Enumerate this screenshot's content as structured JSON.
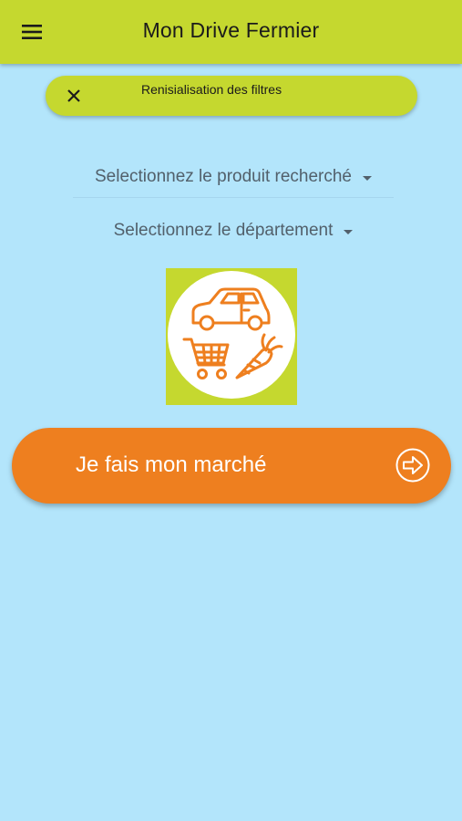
{
  "app_bar": {
    "title": "Mon Drive Fermier",
    "menu_icon": "hamburger-menu-icon"
  },
  "reset_chip": {
    "label": "Renisialisation des filtres",
    "icon": "close-icon"
  },
  "filters": {
    "product_placeholder": "Selectionnez le produit recherché",
    "department_placeholder": "Selectionnez le département",
    "dropdown_icon": "caret-down-icon"
  },
  "logo": {
    "icons": [
      "car-icon",
      "shopping-cart-icon",
      "carrot-icon"
    ]
  },
  "cta": {
    "label": "Je fais mon marché",
    "icon": "arrow-right-circle-icon"
  },
  "colors": {
    "background": "#b3e5fb",
    "app_bar": "#c5d82f",
    "accent_orange": "#ee7f1f",
    "text_dark": "#1b1b1b",
    "dropdown_text": "#52606b"
  }
}
